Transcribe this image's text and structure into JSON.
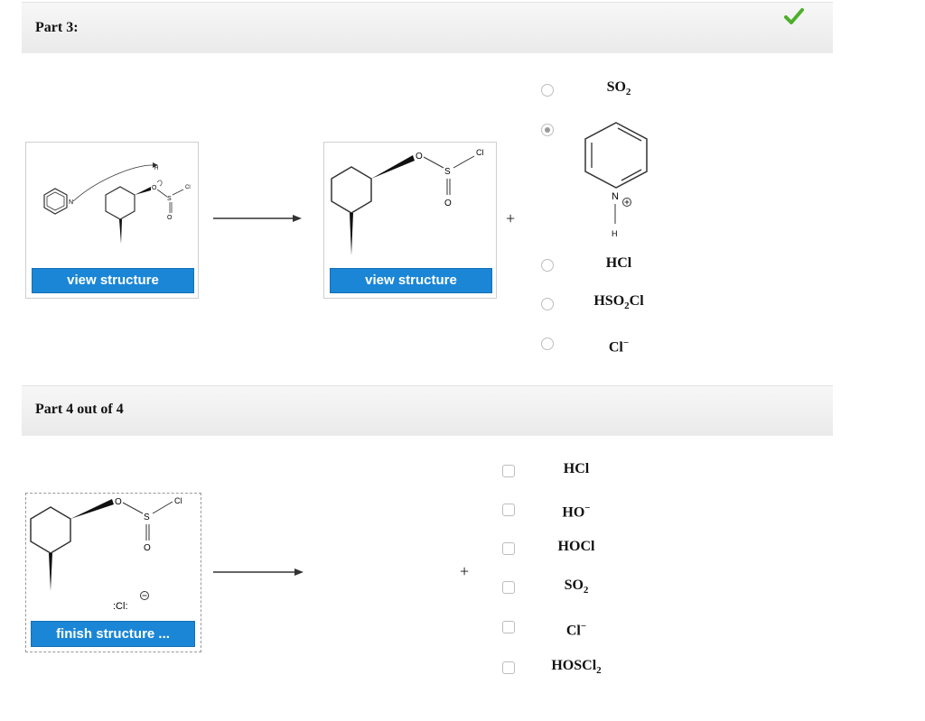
{
  "part3": {
    "title": "Part 3:",
    "view_label_1": "view structure",
    "view_label_2": "view structure",
    "plus": "+",
    "options": [
      {
        "base": "SO",
        "sub": "2",
        "rest": "",
        "sup": "",
        "selected": false
      },
      {
        "kind": "pyridinium",
        "selected": true
      },
      {
        "base": "HCl",
        "sub": "",
        "rest": "",
        "sup": "",
        "selected": false
      },
      {
        "base": "HSO",
        "sub": "2",
        "rest": "Cl",
        "sup": "",
        "selected": false
      },
      {
        "base": "Cl",
        "sub": "",
        "rest": "",
        "sup": "−",
        "selected": false
      }
    ],
    "status_icon": "checkmark-icon"
  },
  "part4": {
    "title": "Part 4 out of 4",
    "finish_label": "finish structure ...",
    "plus": "+",
    "options": [
      {
        "base": "HCl",
        "sub": "",
        "rest": "",
        "sup": ""
      },
      {
        "base": "HO",
        "sub": "",
        "rest": "",
        "sup": "−"
      },
      {
        "base": "HOCl",
        "sub": "",
        "rest": "",
        "sup": ""
      },
      {
        "base": "SO",
        "sub": "2",
        "rest": "",
        "sup": ""
      },
      {
        "base": "Cl",
        "sub": "",
        "rest": "",
        "sup": "−"
      },
      {
        "base": "HOSCl",
        "sub": "2",
        "rest": "",
        "sup": ""
      }
    ]
  },
  "molecule_labels": {
    "o": "O",
    "s": "S",
    "cl": "Cl",
    "n": "N",
    "h": "H",
    "chloride": ":Cl:"
  },
  "colors": {
    "accent": "#1b86d6",
    "check": "#4caf2a"
  }
}
